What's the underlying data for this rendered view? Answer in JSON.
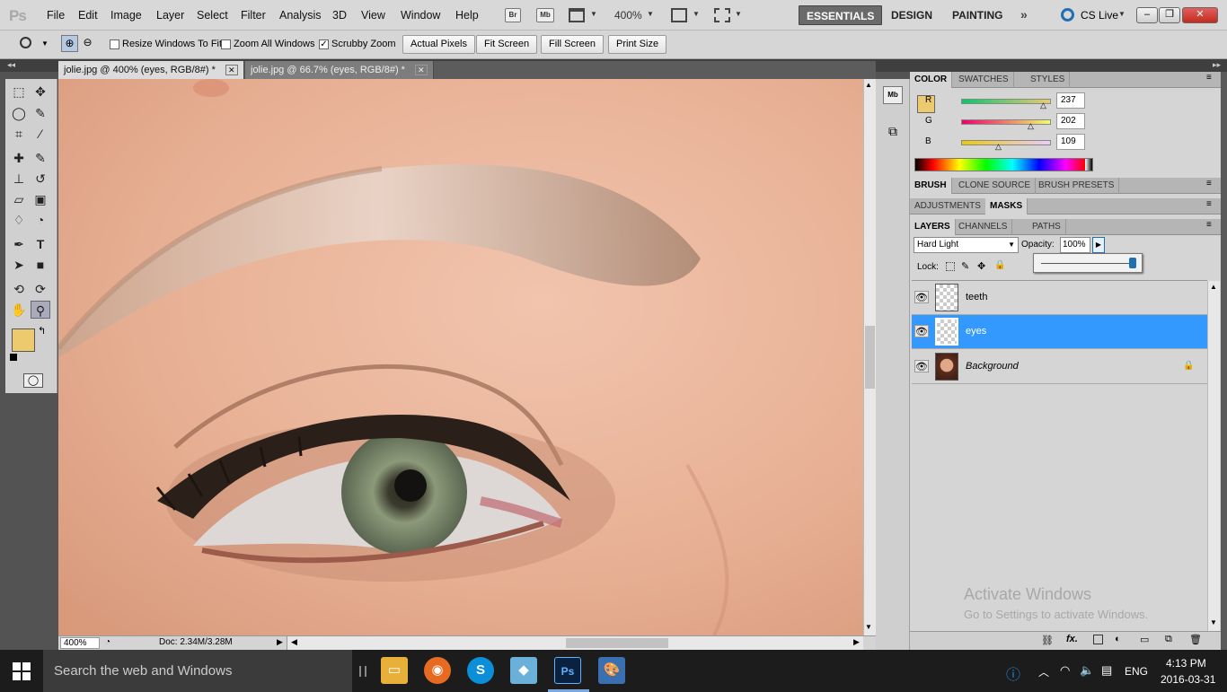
{
  "app": {
    "logo": "Ps"
  },
  "menu": [
    "File",
    "Edit",
    "Image",
    "Layer",
    "Select",
    "Filter",
    "Analysis",
    "3D",
    "View",
    "Window",
    "Help"
  ],
  "appbar": {
    "br_label": "Br",
    "mb_label": "Mb",
    "zoom": "400%"
  },
  "workspaces": [
    "ESSENTIALS",
    "DESIGN",
    "PAINTING"
  ],
  "cs_live": "CS Live",
  "options": {
    "resize_windows": "Resize Windows To Fit",
    "resize_checked": false,
    "zoom_all": "Zoom All Windows",
    "zoom_all_checked": false,
    "scrubby": "Scrubby Zoom",
    "scrubby_checked": true,
    "actual_pixels": "Actual Pixels",
    "fit_screen": "Fit Screen",
    "fill_screen": "Fill Screen",
    "print_size": "Print Size"
  },
  "tabs": [
    {
      "label": "jolie.jpg @ 400% (eyes, RGB/8#) *",
      "active": true
    },
    {
      "label": "jolie.jpg @ 66.7% (eyes, RGB/8#) *",
      "active": false
    }
  ],
  "status": {
    "zoom": "400%",
    "doc": "Doc: 2.34M/3.28M"
  },
  "color_panel": {
    "tabs": [
      "COLOR",
      "SWATCHES",
      "STYLES"
    ],
    "r_label": "R",
    "g_label": "G",
    "b_label": "B",
    "r": "237",
    "g": "202",
    "b": "109",
    "foreground": "#edca6d",
    "background": "#c8c4c8"
  },
  "brush_tabs": [
    "BRUSH",
    "CLONE SOURCE",
    "BRUSH PRESETS"
  ],
  "adjust_tabs": [
    "ADJUSTMENTS",
    "MASKS"
  ],
  "layers_panel": {
    "tabs": [
      "LAYERS",
      "CHANNELS",
      "PATHS"
    ],
    "blend_mode": "Hard Light",
    "opacity_label": "Opacity:",
    "opacity": "100%",
    "lock_label": "Lock:",
    "layers": [
      {
        "name": "teeth",
        "selected": false
      },
      {
        "name": "eyes",
        "selected": true
      },
      {
        "name": "Background",
        "selected": false,
        "locked": true
      }
    ]
  },
  "watermark": {
    "title": "Activate Windows",
    "subtitle": "Go to Settings to activate Windows."
  },
  "taskbar": {
    "search": "Search the web and Windows",
    "lang": "ENG",
    "time": "4:13 PM",
    "date": "2016-03-31"
  }
}
